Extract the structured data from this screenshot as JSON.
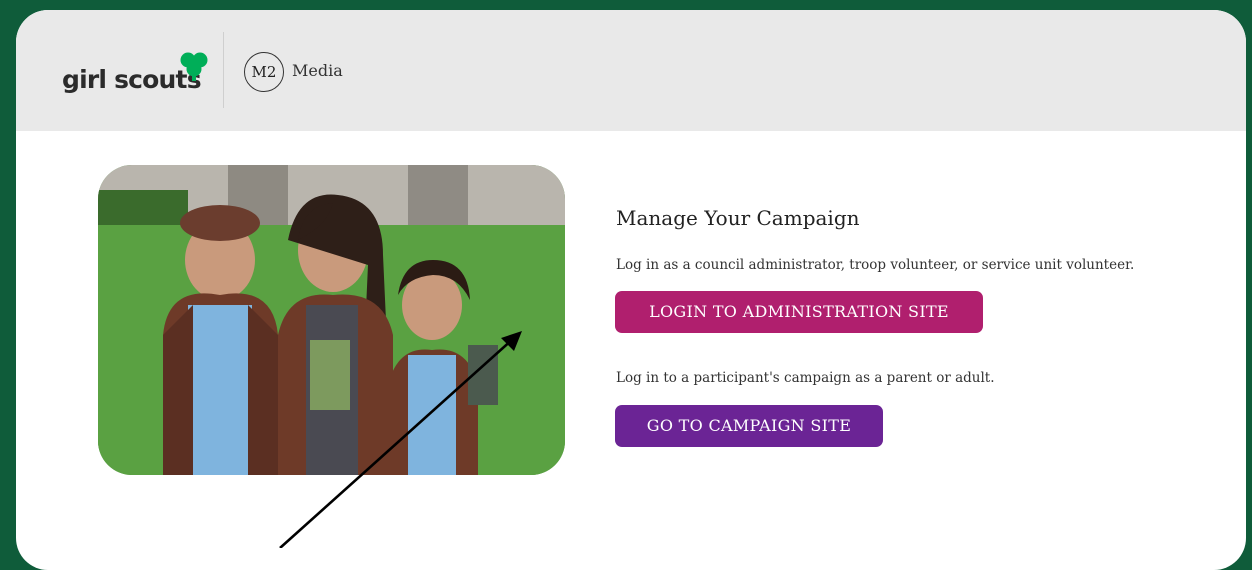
{
  "header": {
    "brand_text": "girl scouts",
    "partner_logo_text": "M2",
    "partner_name": "Media"
  },
  "main": {
    "title": "Manage Your Campaign",
    "admin_description": "Log in as a council administrator, troop volunteer, or service unit volunteer.",
    "admin_button_label": "LOGIN TO ADMINISTRATION SITE",
    "campaign_description": "Log in to a participant's campaign as a parent or adult.",
    "campaign_button_label": "GO TO CAMPAIGN SITE"
  },
  "colors": {
    "frame_green": "#0f5c3a",
    "header_gray": "#e9e9e9",
    "admin_button": "#b01f6e",
    "campaign_button": "#6b2495",
    "trefoil_green": "#00ae58"
  },
  "icons": {
    "brand_mark": "trefoil-icon",
    "annotation": "arrow-icon"
  }
}
